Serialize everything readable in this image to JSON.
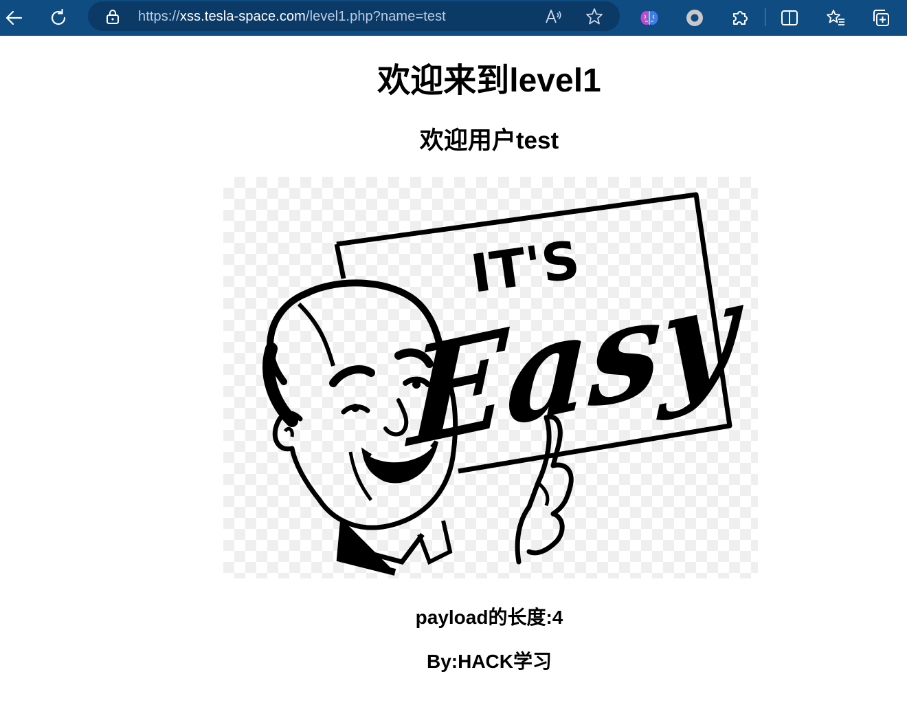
{
  "browser": {
    "url_scheme": "https://",
    "url_host": "xss.tesla-space.com",
    "url_path": "/level1.php?name=test",
    "accent_color": "#0f4c81",
    "icons": [
      "back-arrow-icon",
      "refresh-icon",
      "lock-icon",
      "read-aloud-icon",
      "favorite-star-icon",
      "copilot-brain-icon",
      "record-circle-icon",
      "extensions-icon",
      "split-screen-icon",
      "favorites-icon",
      "collections-icon"
    ]
  },
  "page": {
    "title": "欢迎来到level1",
    "welcome": "欢迎用户test",
    "image": {
      "sign_line1": "IT'S",
      "sign_line2": "Easy"
    },
    "payload_length": "payload的长度:4",
    "byline": "By:HACK学习"
  }
}
